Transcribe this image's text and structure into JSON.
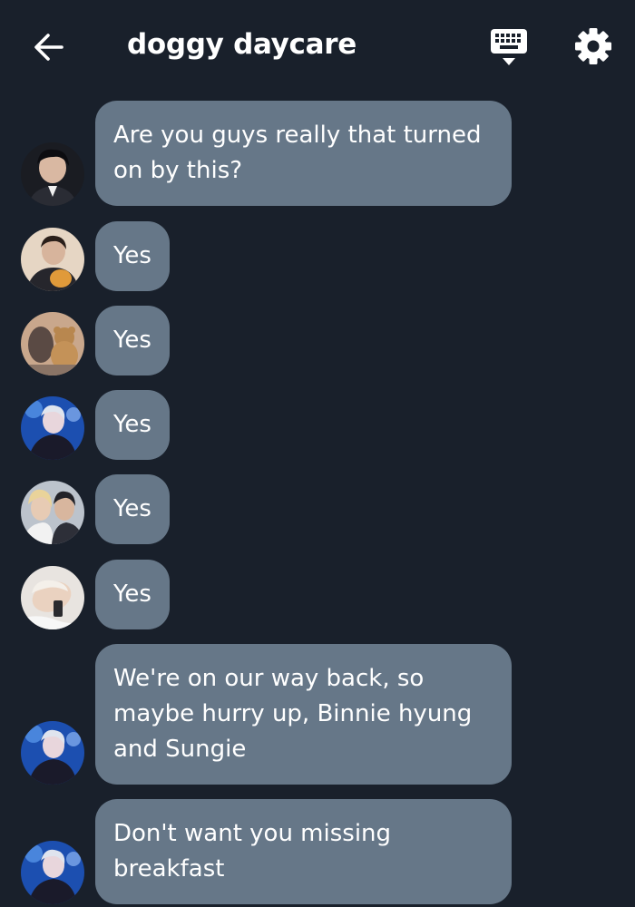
{
  "header": {
    "title": "doggy daycare",
    "back_icon": "arrow-left-icon",
    "keyboard_icon": "keyboard-icon",
    "settings_icon": "gear-icon"
  },
  "colors": {
    "background": "#19202b",
    "bubble": "#667788",
    "text": "#ffffff"
  },
  "messages": [
    {
      "text": "Are you guys really that turned on by this?"
    },
    {
      "text": "Yes"
    },
    {
      "text": "Yes"
    },
    {
      "text": "Yes"
    },
    {
      "text": "Yes"
    },
    {
      "text": "Yes"
    },
    {
      "text": "We're on our way back, so maybe hurry up, Binnie hyung and Sungie"
    },
    {
      "text": "Don't want you missing breakfast"
    }
  ]
}
